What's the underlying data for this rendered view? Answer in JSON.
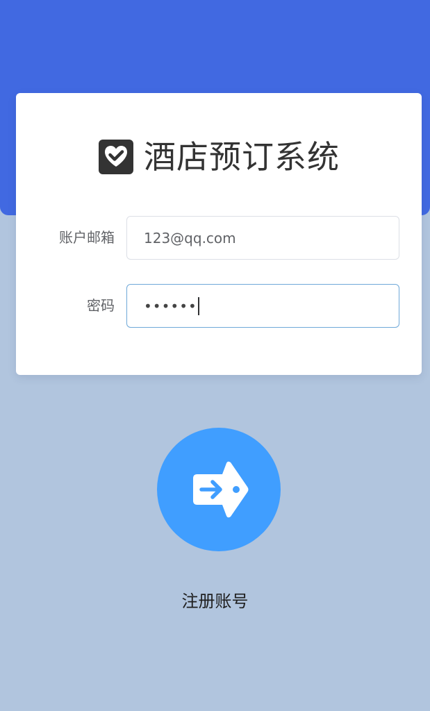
{
  "colors": {
    "top_band": "#4169e1",
    "page_background": "#b1c5de",
    "card_background": "#ffffff",
    "login_button": "#409eff",
    "focused_border": "#6ea8d8"
  },
  "header": {
    "logo_icon": "heart-check-icon",
    "title": "酒店预订系统"
  },
  "form": {
    "email": {
      "label": "账户邮箱",
      "value": "123@qq.com"
    },
    "password": {
      "label": "密码",
      "masked_value": "••••••"
    }
  },
  "actions": {
    "login_icon": "arrow-tag-login-icon",
    "register_label": "注册账号"
  }
}
